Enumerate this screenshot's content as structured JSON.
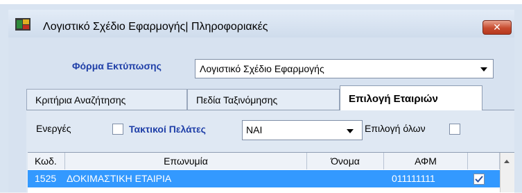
{
  "window": {
    "title": "Λογιστικό Σχέδιο Εφαρμογής| Πληροφοριακές",
    "close_label": "✕"
  },
  "form": {
    "label": "Φόρμα Εκτύπωσης",
    "selected": "Λογιστικό Σχέδιο Εφαρμογής"
  },
  "tabs": [
    {
      "label": "Κριτήρια Αναζήτησης"
    },
    {
      "label": "Πεδία Ταξινόμησης"
    },
    {
      "label": "Επιλογή Εταιριών"
    }
  ],
  "filters": {
    "active_label": "Ενεργές",
    "customers_label": "Τακτικοί Πελάτες",
    "customers_value": "ΝΑΙ",
    "select_all_label": "Επιλογή όλων"
  },
  "grid": {
    "columns": [
      "Κωδ.",
      "Επωνυμία",
      "Όνομα",
      "ΑΦΜ"
    ],
    "rows": [
      {
        "code": "1525",
        "name": "ΔΟΚΙΜΑΣΤΙΚΗ ΕΤΑΙΡΙΑ",
        "first": "",
        "afm": "011111111",
        "checked": true
      }
    ]
  },
  "colors": {
    "accent_label": "#1f3fa8",
    "selection": "#3399ff",
    "close": "#c74b2f"
  }
}
